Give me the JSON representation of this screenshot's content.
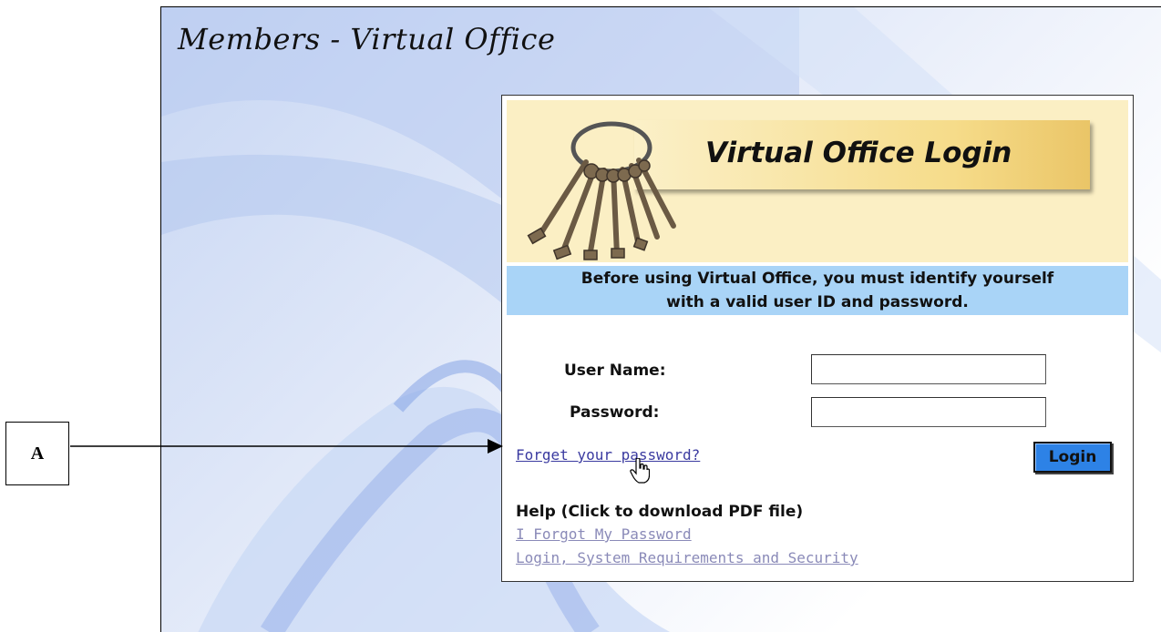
{
  "callout": {
    "label": "A"
  },
  "page": {
    "title": "Members - Virtual Office"
  },
  "login": {
    "banner_title": "Virtual Office Login",
    "notice_line1": "Before using Virtual Office, you must identify yourself",
    "notice_line2": "with a valid user ID and password.",
    "username_label": "User Name:",
    "username_value": "",
    "password_label": "Password:",
    "password_value": "",
    "forgot_link": "Forget your password?",
    "login_button": "Login",
    "help_heading": "Help (Click to download PDF file)",
    "help_links": [
      "I Forgot My Password",
      "Login, System Requirements and Security"
    ]
  },
  "colors": {
    "notice_bg": "#a9d4f7",
    "banner_bg": "#fbefc4",
    "login_button_bg": "#2d82e6",
    "link_color": "#3a3aa0",
    "visited_link_color": "#8a8ab8"
  },
  "icons": [
    "keys-icon",
    "hand-cursor-icon",
    "arrow-pointer-icon"
  ]
}
